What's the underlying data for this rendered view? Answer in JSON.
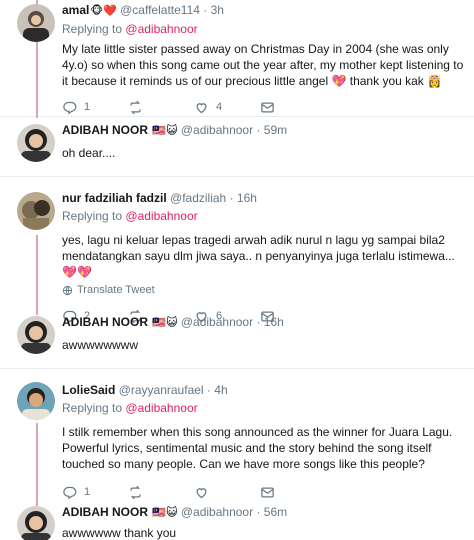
{
  "tweets": [
    {
      "name": "amal",
      "name_emoji": "🐵❤️",
      "handle": "@caffelatte114",
      "time": "3h",
      "replying_prefix": "Replying to",
      "replying_to": "@adibahnoor",
      "text": "My late little sister passed away on Christmas Day in 2004 (she was only 4y.o) so when this song came out the year after, my mother kept listening to it because it reminds us of our precious little angel 💖 thank you kak 👸",
      "replies": "1",
      "retweets": "",
      "likes": "4"
    },
    {
      "name": "ADIBAH NOOR",
      "name_emoji": "🇲🇾😺",
      "handle": "@adibahnoor",
      "time": "59m",
      "text": "oh dear...."
    },
    {
      "name": "nur fadziliah fadzil",
      "name_emoji": "",
      "handle": "@fadziliah",
      "time": "16h",
      "replying_prefix": "Replying to",
      "replying_to": "@adibahnoor",
      "text": "yes, lagu ni keluar lepas tragedi arwah adik nurul n lagu yg sampai bila2 mendatangkan sayu dlm jiwa saya.. n penyanyinya juga terlalu istimewa... 💖💖",
      "translate": "Translate Tweet",
      "replies": "2",
      "retweets": "",
      "likes": "6"
    },
    {
      "name": "ADIBAH NOOR",
      "name_emoji": "🇲🇾😺",
      "handle": "@adibahnoor",
      "time": "16h",
      "text": "awwwwwwww"
    },
    {
      "name": "LolieSaid",
      "name_emoji": "",
      "handle": "@rayyanraufael",
      "time": "4h",
      "replying_prefix": "Replying to",
      "replying_to": "@adibahnoor",
      "text": "I stilk remember when this song announced as the winner for Juara Lagu. Powerful lyrics, sentimental music and the story behind the song itself touched so many people. Can we have more songs like this people?",
      "replies": "1",
      "retweets": "",
      "likes": ""
    },
    {
      "name": "ADIBAH NOOR",
      "name_emoji": "🇲🇾😺",
      "handle": "@adibahnoor",
      "time": "56m",
      "text": "awwwwww thank you"
    }
  ],
  "colors": {
    "thread_line": "#d7a6b2",
    "mention": "#e0245e",
    "muted": "#657786"
  },
  "icons": [
    "reply-icon",
    "retweet-icon",
    "like-icon",
    "dm-icon",
    "globe-icon"
  ]
}
